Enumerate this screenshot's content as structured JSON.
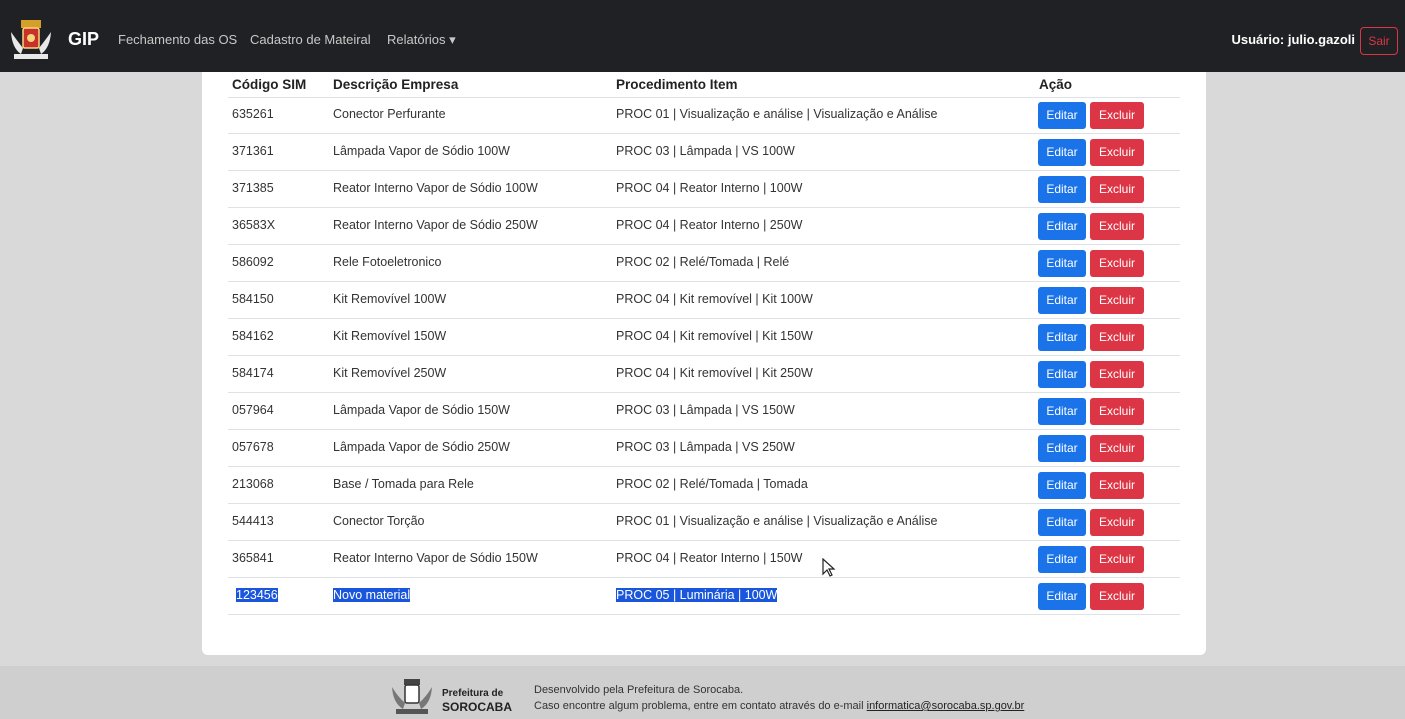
{
  "nav": {
    "brand": "GIP",
    "links": [
      "Fechamento das OS",
      "Cadastro de Mateiral",
      "Relatórios ▾"
    ],
    "user": "Usuário: julio.gazoli",
    "logout": "Sair"
  },
  "table": {
    "headers": [
      "Código SIM",
      "Descrição Empresa",
      "Procedimento Item",
      "Ação"
    ],
    "rows": [
      {
        "code": "635261",
        "desc": "Conector Perfurante",
        "proc": "PROC 01 | Visualização e análise | Visualização e Análise"
      },
      {
        "code": "371361",
        "desc": "Lâmpada Vapor de Sódio 100W",
        "proc": "PROC 03 | Lâmpada | VS 100W"
      },
      {
        "code": "371385",
        "desc": "Reator Interno Vapor de Sódio 100W",
        "proc": "PROC 04 | Reator Interno | 100W"
      },
      {
        "code": "36583X",
        "desc": "Reator Interno Vapor de Sódio 250W",
        "proc": "PROC 04 | Reator Interno | 250W"
      },
      {
        "code": "586092",
        "desc": "Rele Fotoeletronico",
        "proc": "PROC 02 | Relé/Tomada | Relé"
      },
      {
        "code": "584150",
        "desc": "Kit Removível 100W",
        "proc": "PROC 04 | Kit removível | Kit 100W"
      },
      {
        "code": "584162",
        "desc": "Kit Removível 150W",
        "proc": "PROC 04 | Kit removível | Kit 150W"
      },
      {
        "code": "584174",
        "desc": "Kit Removível 250W",
        "proc": "PROC 04 | Kit removível | Kit 250W"
      },
      {
        "code": "057964",
        "desc": "Lâmpada Vapor de Sódio 150W",
        "proc": "PROC 03 | Lâmpada | VS 150W"
      },
      {
        "code": "057678",
        "desc": "Lâmpada Vapor de Sódio 250W",
        "proc": "PROC 03 | Lâmpada | VS 250W"
      },
      {
        "code": "213068",
        "desc": "Base / Tomada para Rele",
        "proc": "PROC 02 | Relé/Tomada | Tomada"
      },
      {
        "code": "544413",
        "desc": "Conector Torção",
        "proc": "PROC 01 | Visualização e análise | Visualização e Análise"
      },
      {
        "code": "365841",
        "desc": "Reator Interno Vapor de Sódio 150W",
        "proc": "PROC 04 | Reator Interno | 150W"
      },
      {
        "code": "123456",
        "desc": "Novo material",
        "proc": "PROC 05 | Luminária | 100W"
      }
    ],
    "edit_label": "Editar",
    "delete_label": "Excluir"
  },
  "footer": {
    "brand_line1": "Prefeitura de",
    "brand_line2": "SOROCABA",
    "line1": "Desenvolvido pela Prefeitura de Sorocaba.",
    "line2": "Caso encontre algum problema, entre em contato através do e-mail ",
    "email": "informatica@sorocaba.sp.gov.br"
  },
  "colors": {
    "edit": "#1a73e8",
    "delete": "#dc3545",
    "navbar": "#202124",
    "selection": "#1a56db"
  }
}
